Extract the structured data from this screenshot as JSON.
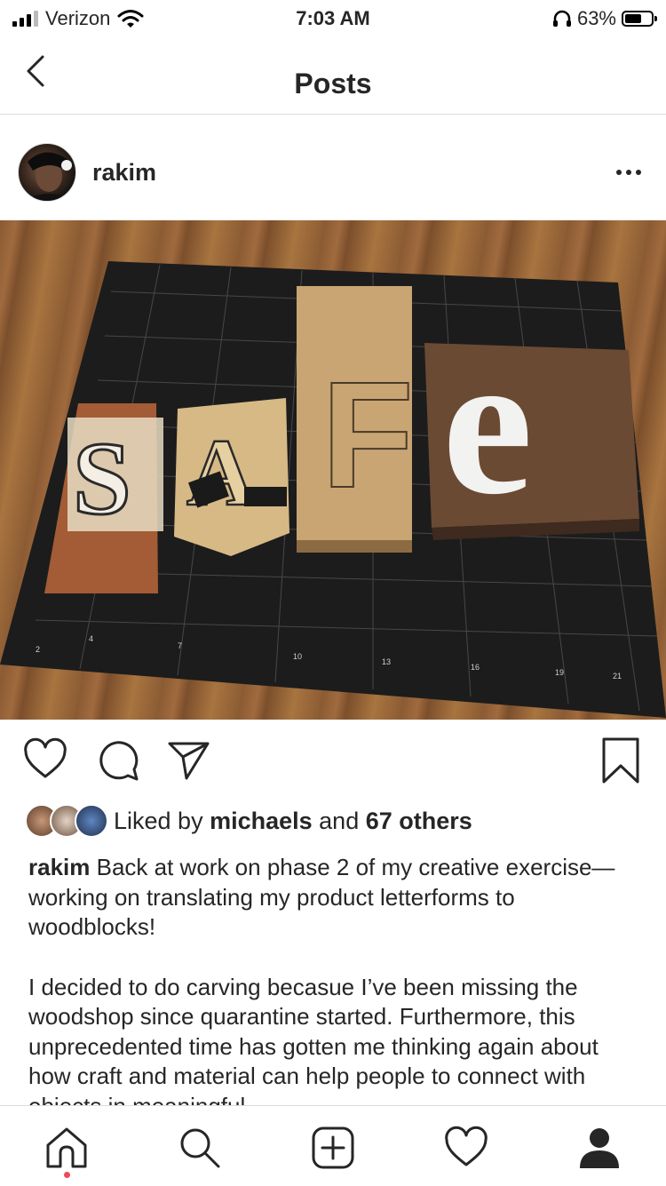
{
  "status_bar": {
    "carrier": "Verizon",
    "time": "7:03 AM",
    "battery": "63%",
    "battery_level": 0.63,
    "signal_bars": 3,
    "icons": [
      "signal-icon",
      "wifi-icon",
      "headphones-icon",
      "battery-icon"
    ]
  },
  "nav": {
    "title": "Posts",
    "back_icon": "chevron-left-icon"
  },
  "post": {
    "username": "rakim",
    "more_icon": "ellipsis-icon",
    "photo": {
      "blocks": [
        "S",
        "A",
        "F",
        "e"
      ]
    },
    "actions": [
      "heart-icon",
      "comment-icon",
      "share-icon",
      "bookmark-icon"
    ],
    "likes": {
      "prefix": "Liked by ",
      "user": "michaels",
      "middle": " and ",
      "others": "67 others"
    },
    "caption": {
      "author": "rakim",
      "paragraph1": "Back at work on phase 2 of my creative exercise—working on translating my product letterforms to woodblocks!",
      "paragraph2": "I decided to do carving becasue I’ve been missing the woodshop since quarantine started. Furthermore, this unprecedented time has gotten me thinking again about how craft and material can help people to connect with objects in meaningful"
    }
  },
  "tab_bar": {
    "items": [
      "home-icon",
      "search-icon",
      "new-post-icon",
      "activity-icon",
      "profile-icon"
    ],
    "accent": "#ed4956"
  }
}
